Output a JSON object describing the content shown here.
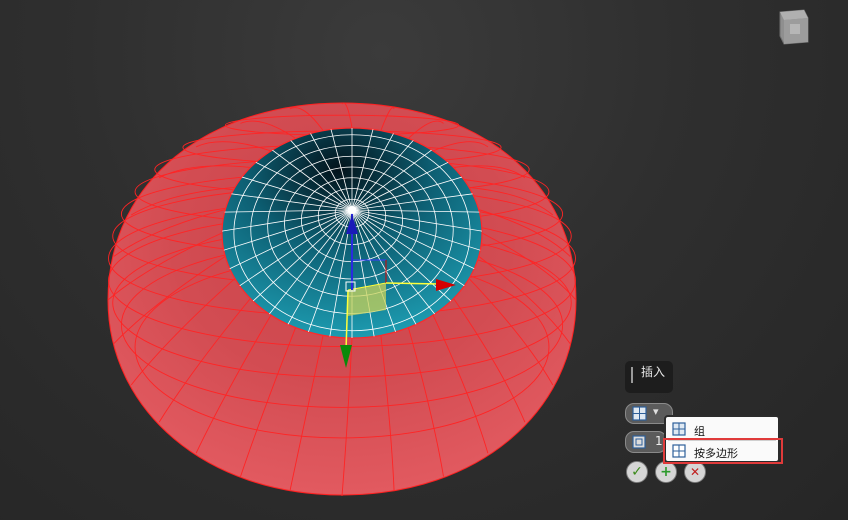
{
  "caddy": {
    "title": "插入",
    "amount_value": "1",
    "ok_label": "✓",
    "apply_label": "+",
    "cancel_label": "✕",
    "mode_options": [
      {
        "label": "组",
        "icon": "group-icon"
      },
      {
        "label": "按多边形",
        "icon": "by-polygon-icon"
      }
    ],
    "selected_option_index": 1
  },
  "colors": {
    "viewport_bg": "#2f2f2f",
    "mesh_red": "#e0454c",
    "wire_red": "#ff1a1a",
    "inner_teal": "#1a8fa3",
    "highlight": "#e03a3a",
    "gizmo_x": "#d40000",
    "gizmo_y": "#0a8a0a",
    "gizmo_z": "#1a1ab8",
    "gizmo_plane": "#c9d35a"
  },
  "icons": [
    "viewcube-icon",
    "group-icon",
    "by-polygon-icon",
    "check-icon",
    "plus-icon",
    "close-icon",
    "dropdown-arrow-icon"
  ]
}
